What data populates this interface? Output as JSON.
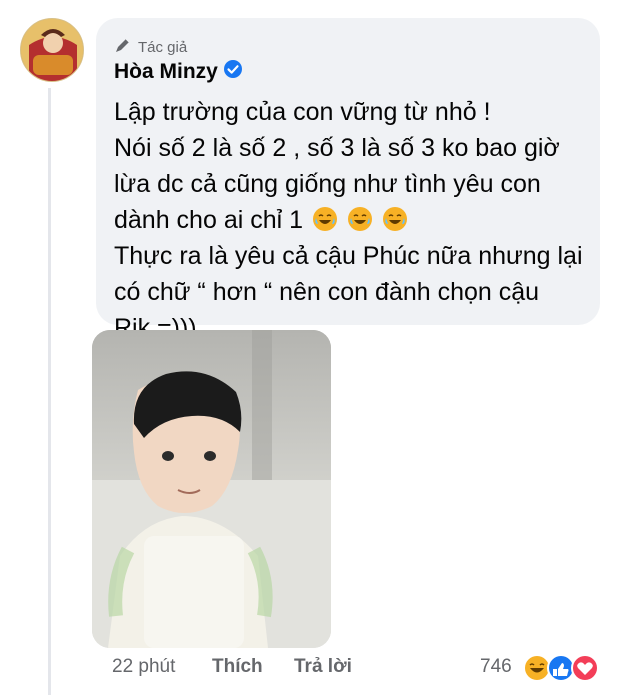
{
  "comment": {
    "badge": "Tác giả",
    "author": "Hòa Minzy",
    "lines": [
      "Lập trường của con vững từ nhỏ !",
      "Nói số 2 là số 2 , số 3 là số 3 ko bao giờ",
      "lừa dc cả cũng giống như tình yêu con",
      "dành cho ai chỉ 1",
      "Thực ra là yêu cả cậu Phúc nữa nhưng lại",
      "có chữ “ hơn “ nên con đành chọn cậu",
      "Rik =)))"
    ],
    "emoji": [
      "laugh-cry-emoji",
      "laugh-cry-emoji",
      "laugh-cry-emoji"
    ]
  },
  "footer": {
    "time": "22 phút",
    "like_label": "Thích",
    "reply_label": "Trả lời",
    "reaction_count": "746",
    "reaction_icons": [
      "haha-icon",
      "like-icon",
      "love-icon"
    ]
  },
  "colors": {
    "bubble": "#f0f2f5",
    "muted": "#65676b",
    "verified": "#1877f2",
    "love": "#f33e58",
    "haha": "#f7b125"
  }
}
